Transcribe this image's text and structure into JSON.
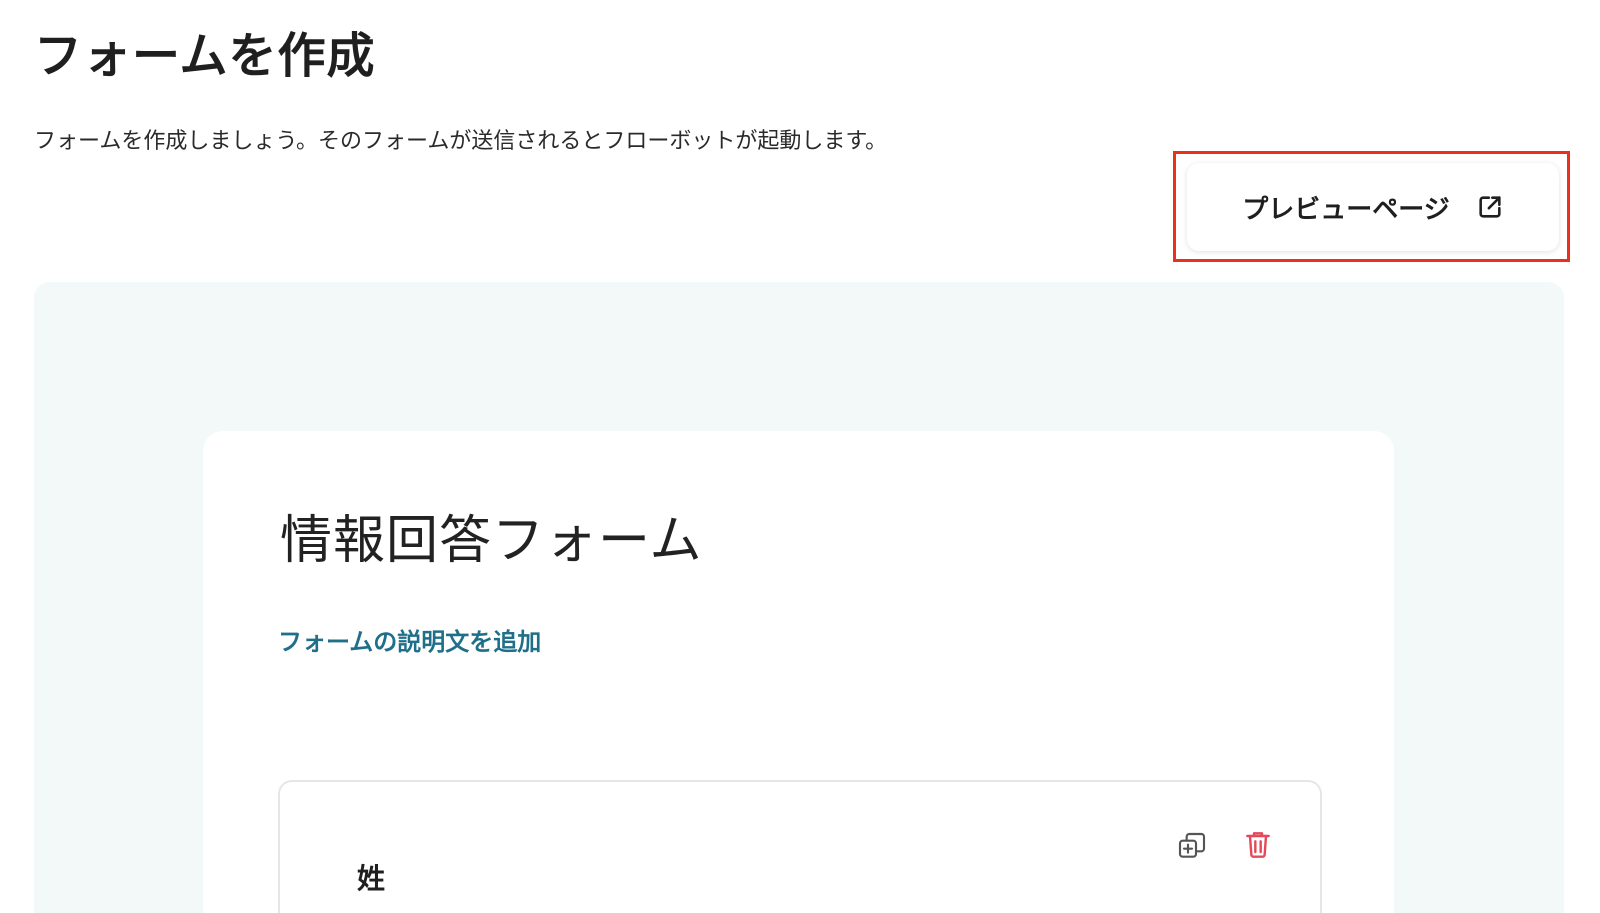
{
  "header": {
    "title": "フォームを作成",
    "description": "フォームを作成しましょう。そのフォームが送信されるとフローボットが起動します。"
  },
  "toolbar": {
    "preview_label": "プレビューページ",
    "preview_icon": "external-link-icon"
  },
  "form": {
    "title": "情報回答フォーム",
    "add_description_label": "フォームの説明文を追加",
    "fields": [
      {
        "label": "姓",
        "actions": [
          {
            "icon": "duplicate-icon"
          },
          {
            "icon": "trash-icon"
          }
        ]
      }
    ]
  },
  "colors": {
    "highlight": "#e8321e",
    "canvas_bg": "#f2f9f8",
    "link": "#1f6f8b",
    "delete": "#e5485a"
  }
}
